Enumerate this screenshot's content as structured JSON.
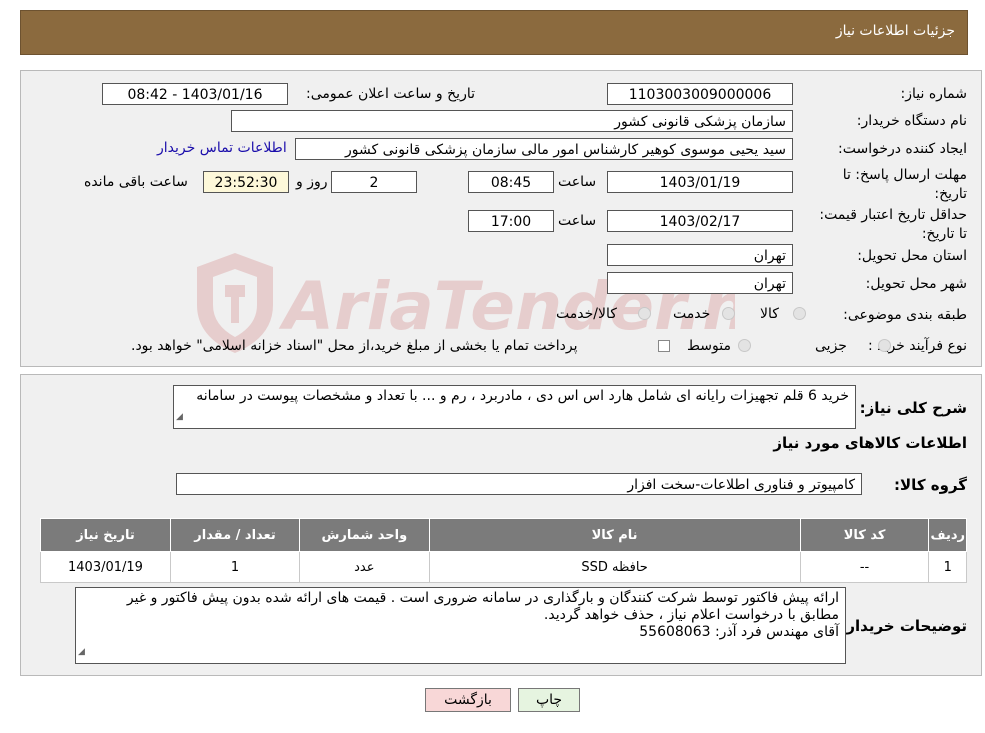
{
  "header": {
    "title": "جزئیات اطلاعات نیاز"
  },
  "details": {
    "need_number_label": "شماره نیاز:",
    "need_number": "1103003009000006",
    "announce_label": "تاریخ و ساعت اعلان عمومی:",
    "announce_value": "1403/01/16 - 08:42",
    "buyer_org_label": "نام دستگاه خریدار:",
    "buyer_org": "سازمان پزشکی قانونی کشور",
    "requester_label": "ایجاد کننده درخواست:",
    "requester": "سید یحیی موسوی کوهیر کارشناس امور مالی سازمان پزشکی قانونی کشور",
    "contact_link": "اطلاعات تماس خریدار",
    "deadline_label": "مهلت ارسال پاسخ: تا تاریخ:",
    "deadline_date": "1403/01/19",
    "time_label": "ساعت",
    "deadline_time": "08:45",
    "days_value": "2",
    "days_label": "روز و",
    "remaining_value": "23:52:30",
    "remaining_label": "ساعت باقی مانده",
    "validity_label": "حداقل تاریخ اعتبار قیمت: تا تاریخ:",
    "validity_date": "1403/02/17",
    "validity_time": "17:00",
    "province_label": "استان محل تحویل:",
    "province": "تهران",
    "city_label": "شهر محل تحویل:",
    "city": "تهران",
    "category_label": "طبقه بندی موضوعی:",
    "category_options": [
      "کالا",
      "خدمت",
      "کالا/خدمت"
    ],
    "process_label": "نوع فرآیند خرید :",
    "process_options": [
      "جزیی",
      "متوسط"
    ],
    "process_note": "پرداخت تمام یا بخشی از مبلغ خرید،از محل \"اسناد خزانه اسلامی\" خواهد بود."
  },
  "description": {
    "label": "شرح کلی نیاز:",
    "text": "خرید 6 قلم تجهیزات رایانه ای شامل هارد اس اس دی ، مادربرد ، رم و ...  با تعداد و مشخصات پیوست در سامانه"
  },
  "goods": {
    "section_title": "اطلاعات کالاهای مورد نیاز",
    "group_label": "گروه کالا:",
    "group_value": "کامپیوتر و فناوری اطلاعات-سخت افزار",
    "columns": [
      "ردیف",
      "کد کالا",
      "نام کالا",
      "واحد شمارش",
      "تعداد / مقدار",
      "تاریخ نیاز"
    ],
    "rows": [
      [
        "1",
        "--",
        "حافظه SSD",
        "عدد",
        "1",
        "1403/01/19"
      ]
    ]
  },
  "buyer_notes": {
    "label": "توضیحات خریدار:",
    "line1": "ارائه پیش فاکتور  توسط شرکت کنندگان و بارگذاری در سامانه ضروری است . قیمت های ارائه شده بدون پیش فاکتور  و غیر",
    "line2": "مطابق با درخواست اعلام نیاز  ، حذف خواهد گردید.",
    "line3": "آقای مهندس فرد آذر:          55608063"
  },
  "buttons": {
    "print": "چاپ",
    "back": "بازگشت"
  },
  "watermark": {
    "text": "AriaTender.neT"
  },
  "colors": {
    "header_bg": "#8b6a3e",
    "back_button_bg": "#f8d7d7",
    "print_button_bg": "#e6f4e0"
  }
}
